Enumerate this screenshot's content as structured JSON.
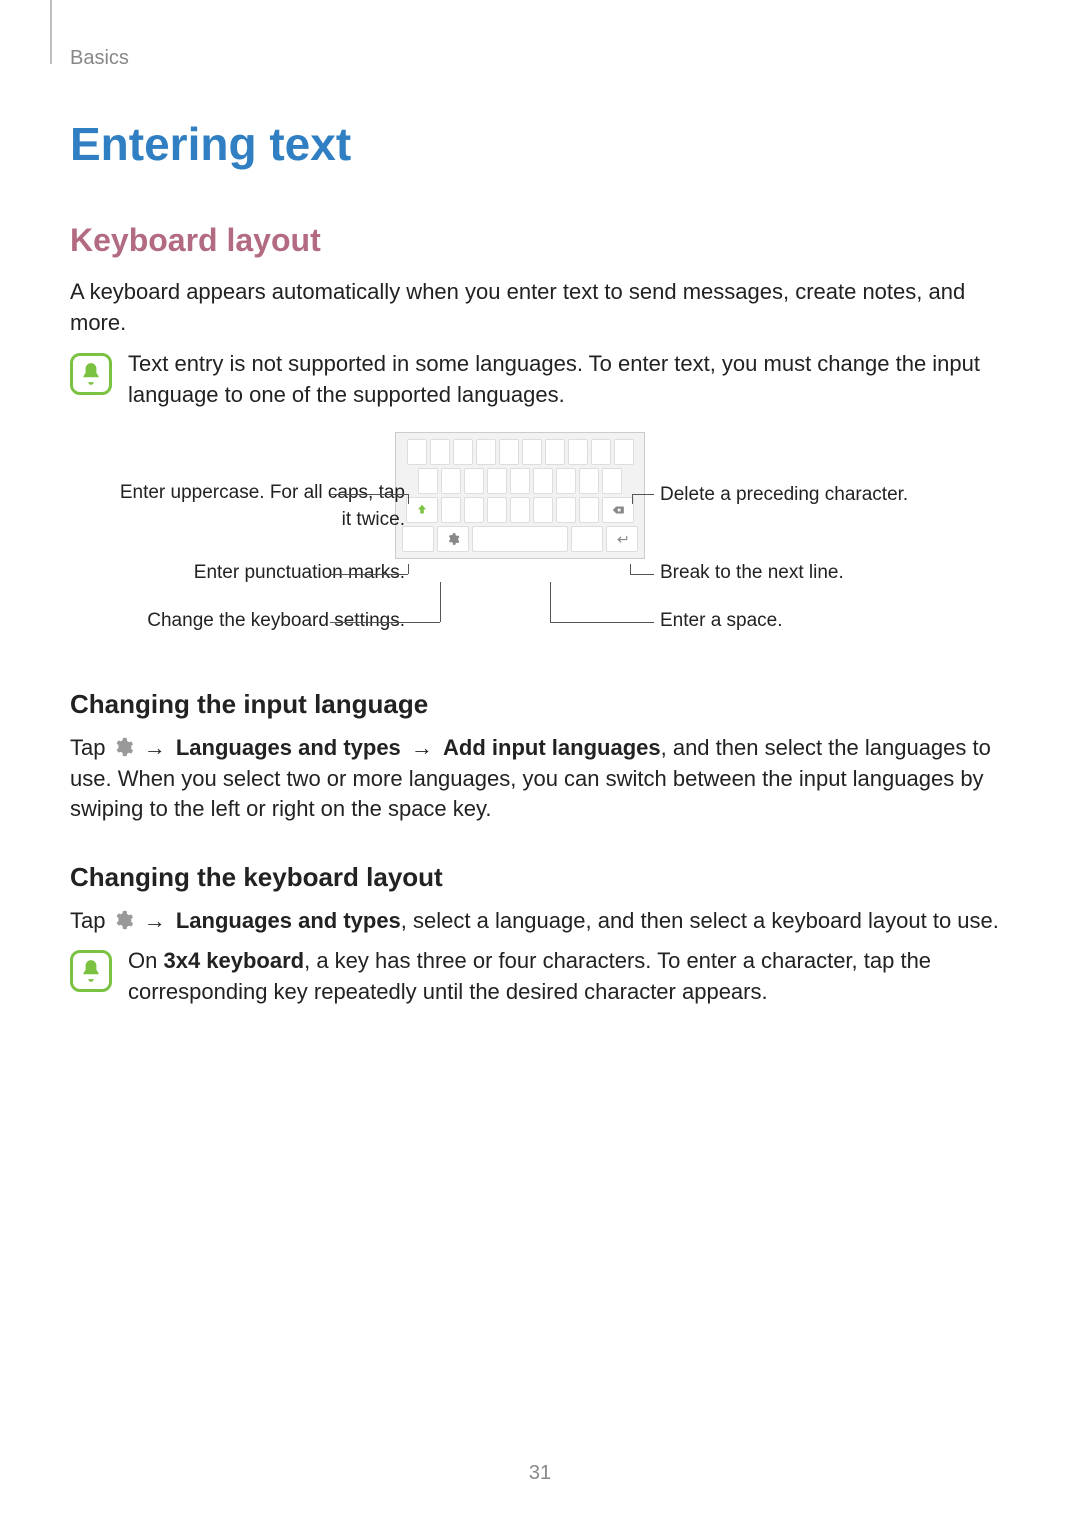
{
  "breadcrumb": "Basics",
  "h1": "Entering text",
  "h2": "Keyboard layout",
  "intro": "A keyboard appears automatically when you enter text to send messages, create notes, and more.",
  "note1": "Text entry is not supported in some languages. To enter text, you must change the input language to one of the supported languages.",
  "callouts": {
    "uppercase_l1": "Enter uppercase. For all caps, tap",
    "uppercase_l2": "it twice.",
    "punctuation": "Enter punctuation marks.",
    "settings": "Change the keyboard settings.",
    "delete": "Delete a preceding character.",
    "nextline": "Break to the next line.",
    "space": "Enter a space."
  },
  "h3a": "Changing the input language",
  "tap": "Tap ",
  "arrow": "→",
  "lang_types": "Languages and types",
  "add_input": "Add input languages",
  "para_lang_tail": ", and then select the languages to use. When you select two or more languages, you can switch between the input languages by swiping to the left or right on the space key.",
  "h3b": "Changing the keyboard layout",
  "para_layout_tail": ", select a language, and then select a keyboard layout to use.",
  "note2_pre": "On ",
  "note2_bold": "3x4 keyboard",
  "note2_tail": ", a key has three or four characters. To enter a character, tap the corresponding key repeatedly until the desired character appears.",
  "page_number": "31"
}
